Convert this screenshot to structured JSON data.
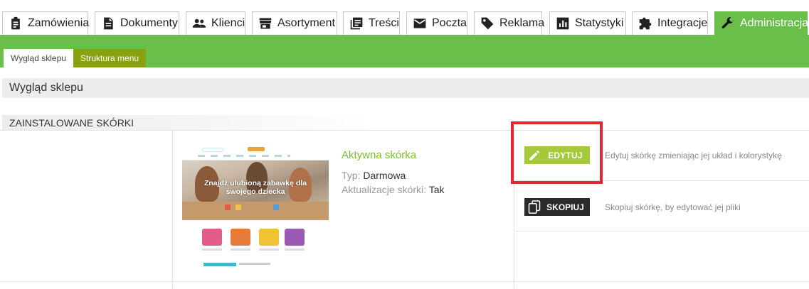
{
  "top_tabs": [
    {
      "label": "Zamówienia",
      "icon": "clipboard-icon"
    },
    {
      "label": "Dokumenty",
      "icon": "document-icon"
    },
    {
      "label": "Klienci",
      "icon": "people-icon"
    },
    {
      "label": "Asortyment",
      "icon": "store-icon"
    },
    {
      "label": "Treści",
      "icon": "content-icon"
    },
    {
      "label": "Poczta",
      "icon": "mail-icon"
    },
    {
      "label": "Reklama",
      "icon": "tag-icon"
    },
    {
      "label": "Statystyki",
      "icon": "chart-icon"
    },
    {
      "label": "Integracje",
      "icon": "puzzle-icon"
    },
    {
      "label": "Administracja",
      "icon": "wrench-icon",
      "active": true
    }
  ],
  "sub_tabs": [
    {
      "label": "Wygląd sklepu",
      "active": true
    },
    {
      "label": "Struktura menu",
      "active": false
    }
  ],
  "page": {
    "title": "Wygląd sklepu",
    "section_title": "ZAINSTALOWANE SKÓRKI"
  },
  "skin": {
    "name": "Aktywna skórka",
    "type_label": "Typ:",
    "type_value": "Darmowa",
    "updates_label": "Aktualizacje skórki:",
    "updates_value": "Tak",
    "preview_caption": "Znajdź ulubioną zabawkę dla swojego dziecka"
  },
  "actions": {
    "edit_label": "EDYTUJ",
    "edit_desc": "Edytuj skórkę zmieniając jej układ i kolorystykę",
    "copy_label": "SKOPIUJ",
    "copy_desc": "Skopiuj skórkę, by edytować jej pliki"
  },
  "colors": {
    "brand_green": "#6abf4b",
    "sub_tab_olive": "#8aa10f",
    "edit_button": "#a6c93a",
    "copy_button": "#2b2b2b",
    "skin_name": "#7cbf2f",
    "highlight": "#e3262f"
  }
}
